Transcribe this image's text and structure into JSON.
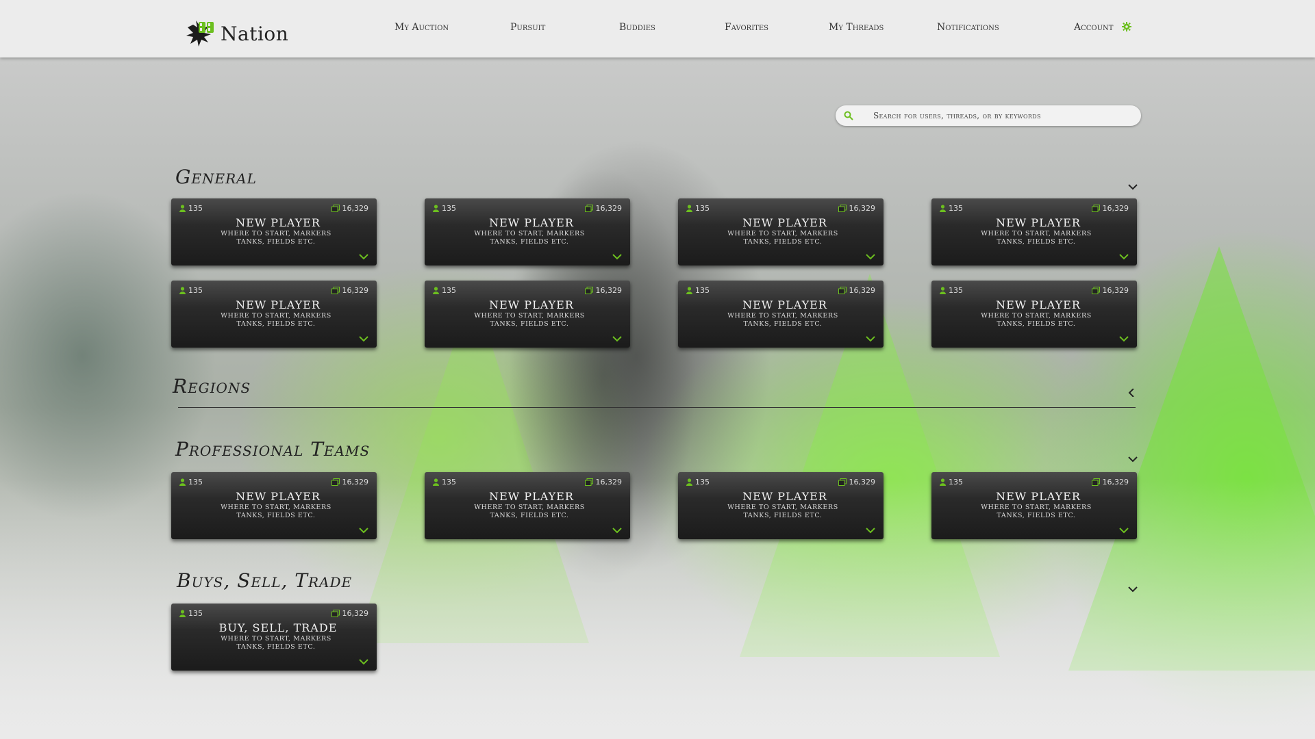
{
  "colors": {
    "accent": "#6cbf1f",
    "card_bg": "#222222",
    "header_bg": "#ececec"
  },
  "header": {
    "logo_text": "Nation",
    "logo_mark": "PB",
    "nav": [
      "My Auction",
      "Pursuit",
      "Buddies",
      "Favorites",
      "My Threads",
      "Notifications",
      "Account"
    ],
    "account_icon": "gear-icon"
  },
  "search": {
    "placeholder": "Search for users, threads, or by keywords",
    "icon": "search-icon"
  },
  "sections": [
    {
      "title": "General",
      "cards": [
        {
          "users": "135",
          "posts": "16,329",
          "title": "NEW PLAYER",
          "desc": "WHERE TO START, MARKERS TANKS, FIELDS ETC."
        },
        {
          "users": "135",
          "posts": "16,329",
          "title": "NEW PLAYER",
          "desc": "WHERE TO START, MARKERS TANKS, FIELDS ETC."
        },
        {
          "users": "135",
          "posts": "16,329",
          "title": "NEW PLAYER",
          "desc": "WHERE TO START, MARKERS TANKS, FIELDS ETC."
        },
        {
          "users": "135",
          "posts": "16,329",
          "title": "NEW PLAYER",
          "desc": "WHERE TO START, MARKERS TANKS, FIELDS ETC."
        },
        {
          "users": "135",
          "posts": "16,329",
          "title": "NEW PLAYER",
          "desc": "WHERE TO START, MARKERS TANKS, FIELDS ETC."
        },
        {
          "users": "135",
          "posts": "16,329",
          "title": "NEW PLAYER",
          "desc": "WHERE TO START, MARKERS TANKS, FIELDS ETC."
        },
        {
          "users": "135",
          "posts": "16,329",
          "title": "NEW PLAYER",
          "desc": "WHERE TO START, MARKERS TANKS, FIELDS ETC."
        },
        {
          "users": "135",
          "posts": "16,329",
          "title": "NEW PLAYER",
          "desc": "WHERE TO START, MARKERS TANKS, FIELDS ETC."
        }
      ]
    },
    {
      "title": "Regions",
      "cards": []
    },
    {
      "title": "Professional Teams",
      "cards": [
        {
          "users": "135",
          "posts": "16,329",
          "title": "NEW PLAYER",
          "desc": "WHERE TO START, MARKERS TANKS, FIELDS ETC."
        },
        {
          "users": "135",
          "posts": "16,329",
          "title": "NEW PLAYER",
          "desc": "WHERE TO START, MARKERS TANKS, FIELDS ETC."
        },
        {
          "users": "135",
          "posts": "16,329",
          "title": "NEW PLAYER",
          "desc": "WHERE TO START, MARKERS TANKS, FIELDS ETC."
        },
        {
          "users": "135",
          "posts": "16,329",
          "title": "NEW PLAYER",
          "desc": "WHERE TO START, MARKERS TANKS, FIELDS ETC."
        }
      ]
    },
    {
      "title": "Buys, Sell, Trade",
      "cards": [
        {
          "users": "135",
          "posts": "16,329",
          "title": "BUY, SELL, TRADE",
          "desc": "WHERE TO START, MARKERS TANKS, FIELDS ETC."
        }
      ]
    }
  ]
}
